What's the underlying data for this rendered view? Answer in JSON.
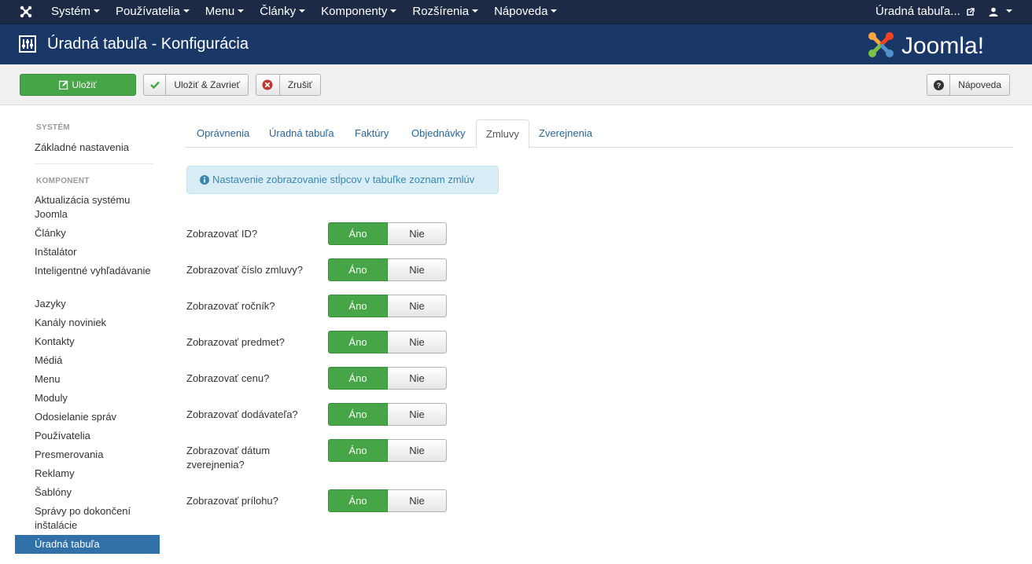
{
  "navbar": {
    "menu": [
      "Systém",
      "Používatelia",
      "Menu",
      "Články",
      "Komponenty",
      "Rozšírenia",
      "Nápoveda"
    ],
    "site_link": "Úradná tabuľa...",
    "user_icon": "user-icon"
  },
  "header": {
    "title": "Úradná tabuľa - Konfigurácia",
    "logo_text": "Joomla!"
  },
  "toolbar": {
    "save": "Uložiť",
    "save_close": "Uložiť & Zavrieť",
    "cancel": "Zrušiť",
    "help": "Nápoveda"
  },
  "sidebar": {
    "system_header": "SYSTÉM",
    "system_item": "Základné nastavenia",
    "component_header": "KOMPONENT",
    "items": [
      "Aktualizácia systému Joomla",
      "Články",
      "Inštalátor",
      "Inteligentné vyhľadávanie",
      "Jazyky",
      "Kanály noviniek",
      "Kontakty",
      "Médiá",
      "Menu",
      "Moduly",
      "Odosielanie správ",
      "Používatelia",
      "Presmerovania",
      "Reklamy",
      "Šablóny",
      "Správy po dokončení inštalácie",
      "Úradná tabuľa"
    ]
  },
  "tabs": [
    "Oprávnenia",
    "Úradná tabuľa",
    "Faktúry",
    "Objednávky",
    "Zmluvy",
    "Zverejnenia"
  ],
  "active_tab": "Zmluvy",
  "alert": "Nastavenie zobrazovanie stĺpcov v tabuľke zoznam zmlúv",
  "fields": [
    {
      "label": "Zobrazovať ID?",
      "yes": "Áno",
      "no": "Nie",
      "value": "Áno"
    },
    {
      "label": "Zobrazovať číslo zmluvy?",
      "yes": "Áno",
      "no": "Nie",
      "value": "Áno"
    },
    {
      "label": "Zobrazovať ročník?",
      "yes": "Áno",
      "no": "Nie",
      "value": "Áno"
    },
    {
      "label": "Zobrazovať predmet?",
      "yes": "Áno",
      "no": "Nie",
      "value": "Áno"
    },
    {
      "label": "Zobrazovať cenu?",
      "yes": "Áno",
      "no": "Nie",
      "value": "Áno"
    },
    {
      "label": "Zobrazovať dodávateľa?",
      "yes": "Áno",
      "no": "Nie",
      "value": "Áno"
    },
    {
      "label": "Zobrazovať dátum zverejnenia?",
      "yes": "Áno",
      "no": "Nie",
      "value": "Áno"
    },
    {
      "label": "Zobrazovať prílohu?",
      "yes": "Áno",
      "no": "Nie",
      "value": "Áno"
    }
  ],
  "colors": {
    "navbar": "#1c2a45",
    "header": "#1a3867",
    "success": "#46a546",
    "link": "#2a6496",
    "active_sidebar": "#3071a9"
  }
}
